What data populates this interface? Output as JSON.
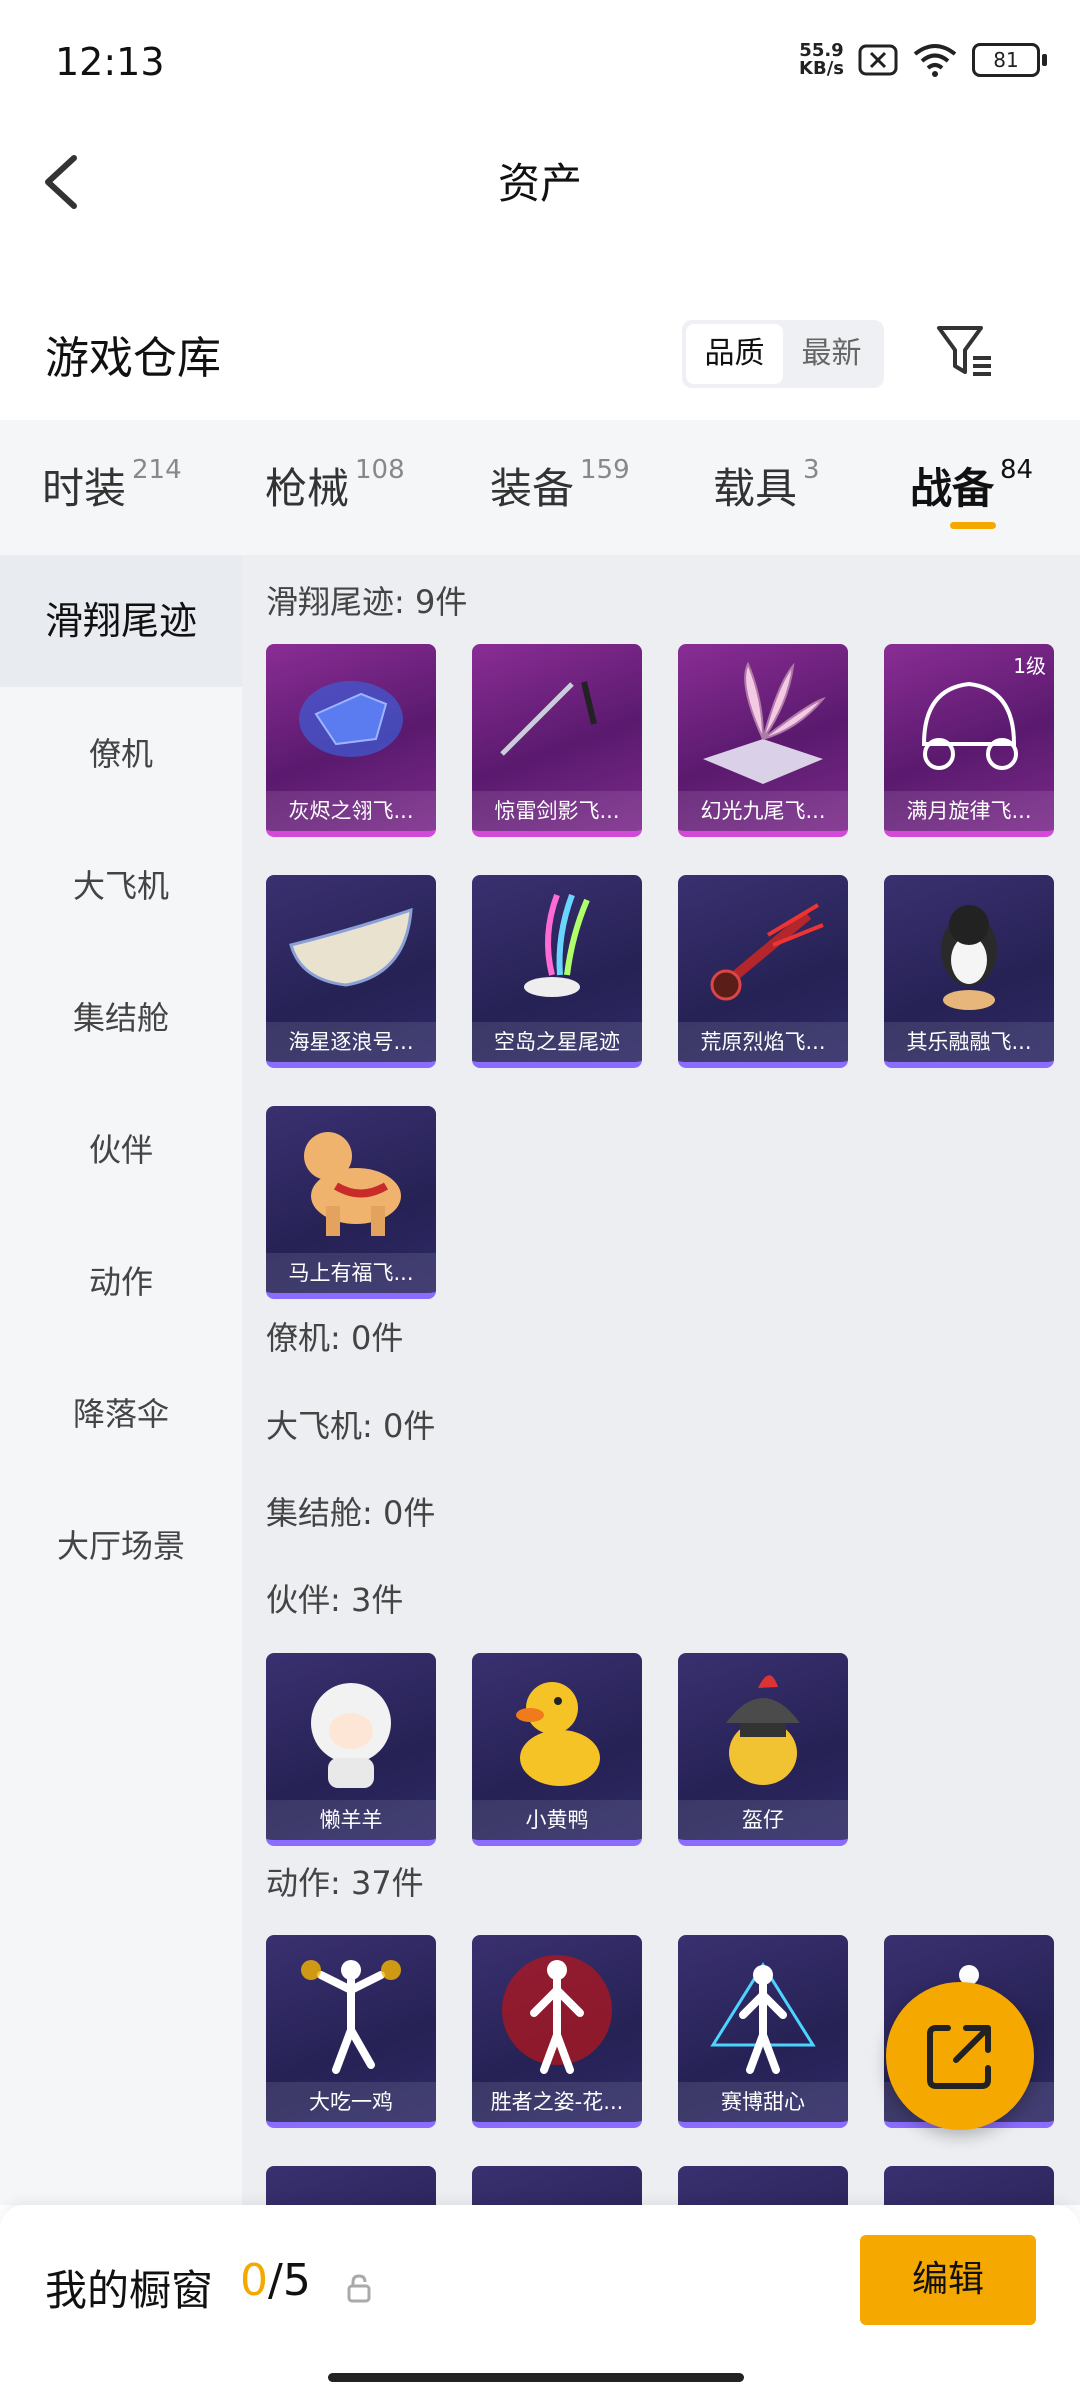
{
  "status": {
    "time": "12:13",
    "net_speed_value": "55.9",
    "net_speed_unit": "KB/s",
    "battery": "81"
  },
  "header": {
    "title": "资产"
  },
  "warehouse": {
    "title": "游戏仓库",
    "sort_options": [
      {
        "label": "品质",
        "active": true
      },
      {
        "label": "最新",
        "active": false
      }
    ]
  },
  "tabs": [
    {
      "label": "时装",
      "count": "214",
      "active": false
    },
    {
      "label": "枪械",
      "count": "108",
      "active": false
    },
    {
      "label": "装备",
      "count": "159",
      "active": false
    },
    {
      "label": "载具",
      "count": "3",
      "active": false
    },
    {
      "label": "战备",
      "count": "84",
      "active": true
    }
  ],
  "sidenav": [
    {
      "label": "滑翔尾迹",
      "active": true
    },
    {
      "label": "僚机",
      "active": false
    },
    {
      "label": "大飞机",
      "active": false
    },
    {
      "label": "集结舱",
      "active": false
    },
    {
      "label": "伙伴",
      "active": false
    },
    {
      "label": "动作",
      "active": false
    },
    {
      "label": "降落伞",
      "active": false
    },
    {
      "label": "大厅场景",
      "active": false
    }
  ],
  "sections": {
    "glide": {
      "header": "滑翔尾迹: 9件",
      "items": [
        {
          "name": "灰烬之翎飞...",
          "rarity": "pink"
        },
        {
          "name": "惊雷剑影飞...",
          "rarity": "pink"
        },
        {
          "name": "幻光九尾飞...",
          "rarity": "pink"
        },
        {
          "name": "满月旋律飞...",
          "rarity": "pink",
          "level": "1级"
        },
        {
          "name": "海星逐浪号...",
          "rarity": "blue"
        },
        {
          "name": "空岛之星尾迹",
          "rarity": "blue"
        },
        {
          "name": "荒原烈焰飞...",
          "rarity": "blue"
        },
        {
          "name": "其乐融融飞...",
          "rarity": "blue"
        },
        {
          "name": "马上有福飞...",
          "rarity": "blue"
        }
      ]
    },
    "wingman": {
      "header": "僚机: 0件"
    },
    "plane": {
      "header": "大飞机: 0件"
    },
    "pod": {
      "header": "集结舱: 0件"
    },
    "partner": {
      "header": "伙伴: 3件",
      "items": [
        {
          "name": "懒羊羊",
          "rarity": "blue"
        },
        {
          "name": "小黄鸭",
          "rarity": "blue"
        },
        {
          "name": "盔仔",
          "rarity": "blue"
        }
      ]
    },
    "emote": {
      "header": "动作: 37件",
      "items": [
        {
          "name": "大吃一鸡",
          "rarity": "blue"
        },
        {
          "name": "胜者之姿-花...",
          "rarity": "blue"
        },
        {
          "name": "赛博甜心",
          "rarity": "blue"
        },
        {
          "name": "",
          "rarity": "blue"
        }
      ]
    }
  },
  "showcase": {
    "label": "我的橱窗",
    "current": "0",
    "separator": "/",
    "max": "5",
    "edit_label": "编辑"
  },
  "colors": {
    "accent": "#f5a800",
    "pink_card": "#8a2d95",
    "blue_card": "#2e2a66"
  }
}
